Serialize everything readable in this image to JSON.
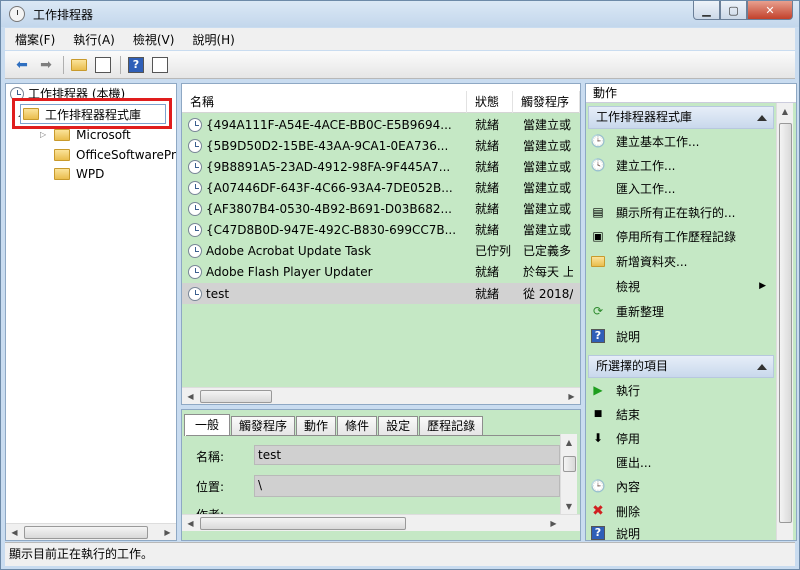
{
  "window": {
    "title": "工作排程器"
  },
  "menu": [
    "檔案(F)",
    "執行(A)",
    "檢視(V)",
    "說明(H)"
  ],
  "toolbar_icons": [
    "back-icon",
    "forward-icon",
    "up-folder-icon",
    "show-hide-pane-icon",
    "help-icon",
    "properties-icon"
  ],
  "tree": {
    "root": "工作排程器 (本機)",
    "library": "工作排程器程式庫",
    "children": [
      "Microsoft",
      "OfficeSoftwarePr",
      "WPD"
    ]
  },
  "list": {
    "columns": [
      "名稱",
      "狀態",
      "觸發程序"
    ],
    "rows": [
      {
        "name": "{494A111F-A54E-4ACE-BB0C-E5B9694...",
        "status": "就緒",
        "trigger": "當建立或"
      },
      {
        "name": "{5B9D50D2-15BE-43AA-9CA1-0EA736...",
        "status": "就緒",
        "trigger": "當建立或"
      },
      {
        "name": "{9B8891A5-23AD-4912-98FA-9F445A7...",
        "status": "就緒",
        "trigger": "當建立或"
      },
      {
        "name": "{A07446DF-643F-4C66-93A4-7DE052B...",
        "status": "就緒",
        "trigger": "當建立或"
      },
      {
        "name": "{AF3807B4-0530-4B92-B691-D03B682...",
        "status": "就緒",
        "trigger": "當建立或"
      },
      {
        "name": "{C47D8B0D-947E-492C-B830-699CC7B...",
        "status": "就緒",
        "trigger": "當建立或"
      },
      {
        "name": "Adobe Acrobat Update Task",
        "status": "已佇列",
        "trigger": "已定義多"
      },
      {
        "name": "Adobe Flash Player Updater",
        "status": "就緒",
        "trigger": "於每天 上"
      },
      {
        "name": "test",
        "status": "就緒",
        "trigger": "從 2018/"
      }
    ]
  },
  "props": {
    "tabs": [
      "一般",
      "觸發程序",
      "動作",
      "條件",
      "設定",
      "歷程記錄"
    ],
    "name_label": "名稱:",
    "name_value": "test",
    "location_label": "位置:",
    "location_value": "\\",
    "author_label": "作者:"
  },
  "actions": {
    "title": "動作",
    "group1": "工作排程器程式庫",
    "items1": [
      "建立基本工作...",
      "建立工作...",
      "匯入工作...",
      "顯示所有正在執行的...",
      "停用所有工作歷程記錄",
      "新增資料夾...",
      "檢視",
      "重新整理",
      "說明"
    ],
    "group2": "所選擇的項目",
    "items2": [
      "執行",
      "結束",
      "停用",
      "匯出...",
      "內容",
      "刪除",
      "說明"
    ]
  },
  "status": "顯示目前正在執行的工作。",
  "colors": {
    "pane_bg": "#c5e8c5",
    "highlight": "#e01d1d",
    "selected_row": "#d2d2d2"
  }
}
